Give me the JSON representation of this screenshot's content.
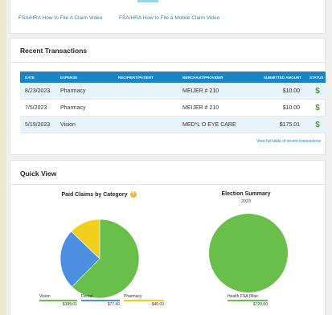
{
  "links": {
    "file_claim_video": "FSA/HRA How to File A Claim Video",
    "mobile_claim_video": "FSA/HRA How to File a Mobile Claim Video"
  },
  "transactions": {
    "title": "Recent Transactions",
    "columns": [
      "DATE",
      "EXPENSE",
      "RECIPIENT/PATIENT",
      "MERCHANT/PROVIDER",
      "SUBMITTED AMOUNT",
      "STATUS"
    ],
    "rows": [
      {
        "date": "8/23/2023",
        "expense": "Pharmacy",
        "recipient": "",
        "merchant": "MEIJER # 210",
        "amount": "$10.00",
        "status": "$"
      },
      {
        "date": "7/5/2023",
        "expense": "Pharmacy",
        "recipient": "",
        "merchant": "MEIJER # 210",
        "amount": "$10.00",
        "status": "$"
      },
      {
        "date": "5/19/2023",
        "expense": "Vision",
        "recipient": "",
        "merchant": "MED*L O EYE CARE",
        "amount": "$175.01",
        "status": "$"
      }
    ],
    "view_full_link": "View full table of recent transactions"
  },
  "quick_view": {
    "title": "Quick View",
    "paid_claims": {
      "title": "Paid Claims by Category",
      "help_icon": "question-icon",
      "legend": [
        {
          "name": "Vision",
          "value": "$195.01",
          "amount": 195.01,
          "color": "#6abf4b"
        },
        {
          "name": "Dental",
          "value": "$77.40",
          "amount": 77.4,
          "color": "#4a8fe0"
        },
        {
          "name": "Pharmacy",
          "value": "$40.00",
          "amount": 40.0,
          "color": "#f2cf1d"
        }
      ]
    },
    "election_summary": {
      "title": "Election Summary",
      "year": "2023",
      "legend": [
        {
          "name": "Health FSA (Max:",
          "value": "$720.00",
          "amount": 720.0,
          "color": "#6abf4b"
        }
      ]
    }
  }
}
